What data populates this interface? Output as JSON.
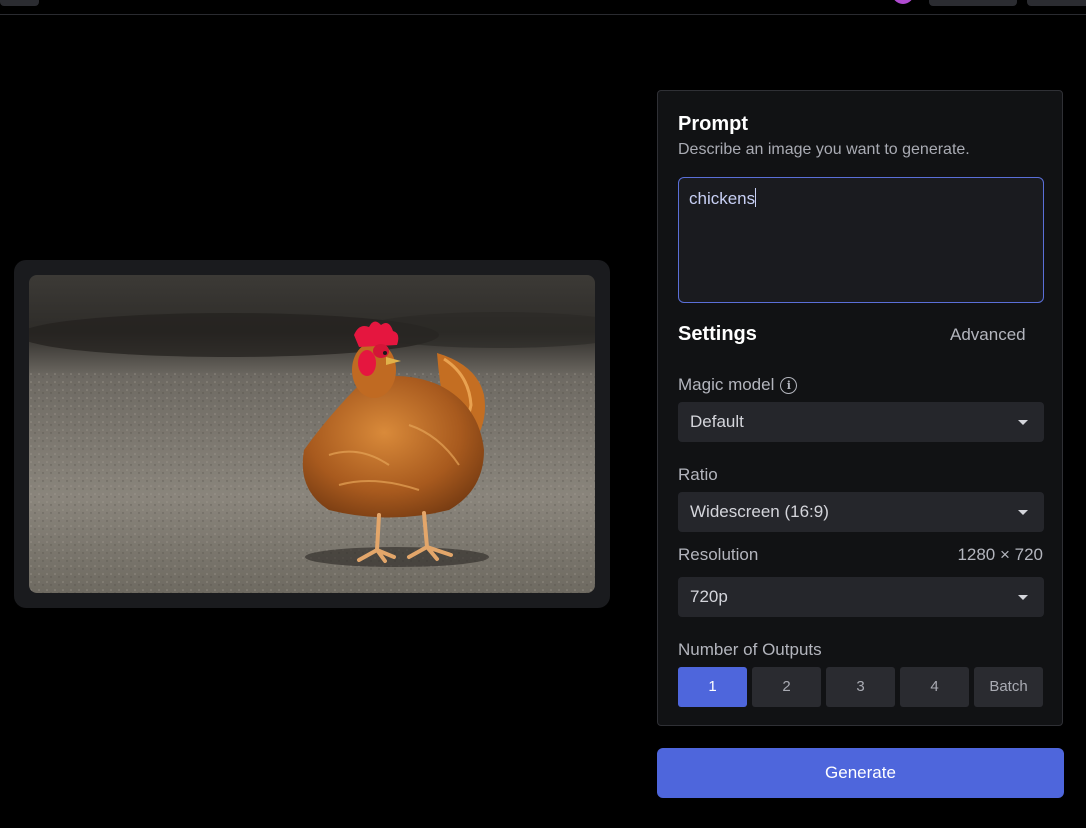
{
  "prompt": {
    "title": "Prompt",
    "description": "Describe an image you want to generate.",
    "value": "chickens"
  },
  "settings": {
    "title": "Settings",
    "advanced_label": "Advanced",
    "magic_model": {
      "label": "Magic model",
      "value": "Default"
    },
    "ratio": {
      "label": "Ratio",
      "value": "Widescreen (16:9)"
    },
    "resolution": {
      "label": "Resolution",
      "dimensions": "1280 × 720",
      "value": "720p"
    },
    "outputs": {
      "label": "Number of Outputs",
      "options": [
        "1",
        "2",
        "3",
        "4",
        "Batch"
      ],
      "selected": "1"
    }
  },
  "generate_label": "Generate",
  "icons": {
    "info": "info-icon",
    "dropdown": "chevron-down-icon"
  },
  "colors": {
    "accent": "#4e66dc",
    "panel_bg": "#111214",
    "control_bg": "#25262b",
    "prompt_border": "#5a6fd8"
  }
}
